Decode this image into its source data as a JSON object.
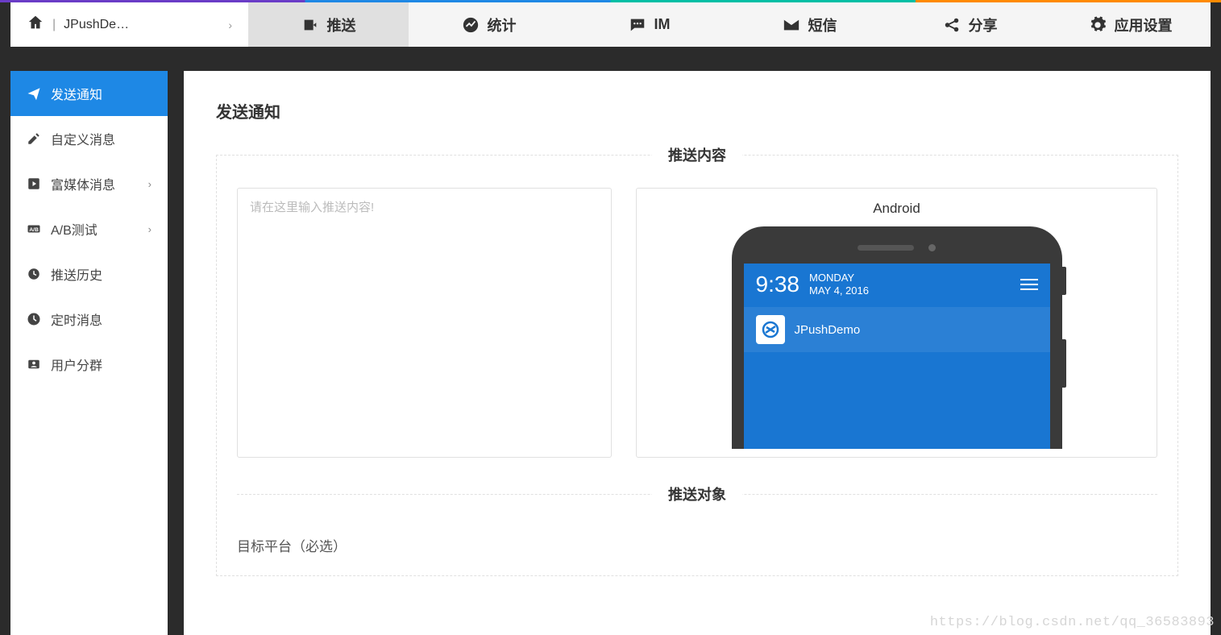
{
  "breadcrumb": {
    "app_name": "JPushDe…"
  },
  "top_tabs": {
    "push": "推送",
    "stats": "统计",
    "im": "IM",
    "sms": "短信",
    "share": "分享",
    "settings": "应用设置"
  },
  "sidebar": {
    "send_notice": "发送通知",
    "custom_msg": "自定义消息",
    "rich_media": "富媒体消息",
    "ab_test": "A/B测试",
    "push_history": "推送历史",
    "scheduled": "定时消息",
    "user_segments": "用户分群"
  },
  "page": {
    "title": "发送通知",
    "section_content": "推送内容",
    "section_target": "推送对象",
    "textarea_placeholder": "请在这里输入推送内容!",
    "target_platform_label": "目标平台（必选）"
  },
  "preview": {
    "platform": "Android",
    "time": "9:38",
    "day": "MONDAY",
    "date": "MAY 4, 2016",
    "notif_title": "JPushDemo"
  },
  "watermark": "https://blog.csdn.net/qq_36583893"
}
